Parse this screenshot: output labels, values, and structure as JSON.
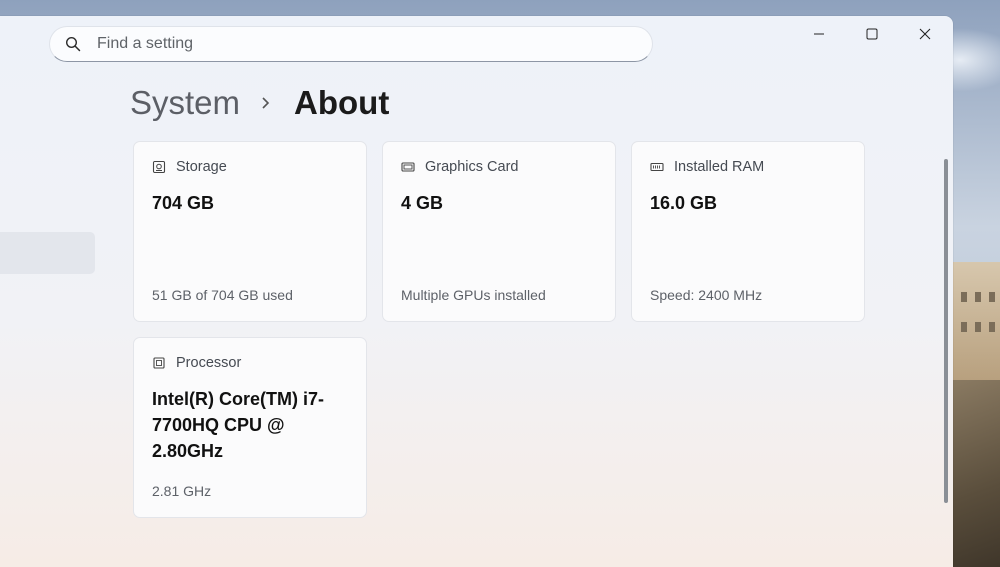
{
  "search": {
    "placeholder": "Find a setting"
  },
  "window_controls": {
    "minimize_icon": "minimize-icon",
    "maximize_icon": "maximize-icon",
    "close_icon": "close-icon"
  },
  "breadcrumb": {
    "parent": "System",
    "current": "About"
  },
  "cards": [
    {
      "label": "Storage",
      "value": "704 GB",
      "detail": "51 GB of 704 GB used",
      "icon": "storage-icon"
    },
    {
      "label": "Graphics Card",
      "value": "4 GB",
      "detail": "Multiple GPUs installed",
      "icon": "graphics-card-icon"
    },
    {
      "label": "Installed RAM",
      "value": "16.0 GB",
      "detail": "Speed: 2400 MHz",
      "icon": "ram-icon"
    },
    {
      "label": "Processor",
      "value": "Intel(R) Core(TM) i7-7700HQ CPU @ 2.80GHz",
      "detail": "2.81 GHz",
      "icon": "processor-icon"
    }
  ]
}
